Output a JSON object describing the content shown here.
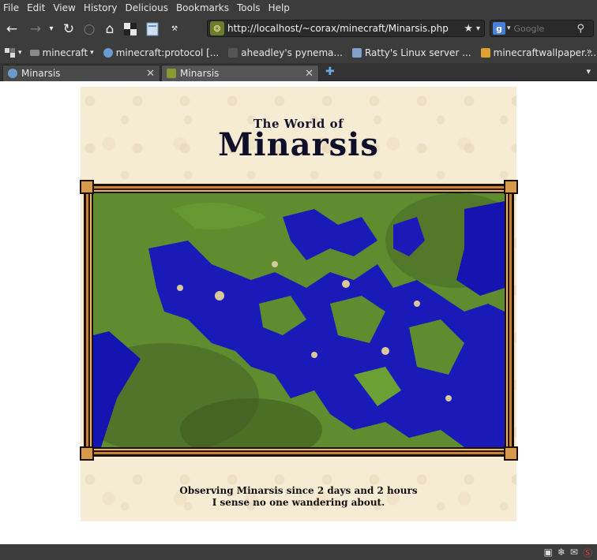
{
  "menu": [
    "File",
    "Edit",
    "View",
    "History",
    "Delicious",
    "Bookmarks",
    "Tools",
    "Help"
  ],
  "urlbar": {
    "url": "http://localhost/~corax/minecraft/Minarsis.php"
  },
  "search": {
    "placeholder": "Google"
  },
  "bookmarks": [
    {
      "label": "minecraft",
      "color": "#8a8a8a"
    },
    {
      "label": "minecraft:protocol [...",
      "color": "#6a9ad0"
    },
    {
      "label": "aheadley's pynema...",
      "color": "#444444"
    },
    {
      "label": "Ratty's Linux server ...",
      "color": "#7fa0c8"
    },
    {
      "label": "minecraftwallpaper....",
      "color": "#e0a030"
    }
  ],
  "tabs": [
    {
      "title": "Minarsis"
    },
    {
      "title": "Minarsis"
    }
  ],
  "page": {
    "title_small": "The World of",
    "title_big": "Minarsis",
    "status_line1": "Observing Minarsis since 2 days and 2 hours",
    "status_line2": "I sense no one wandering about."
  },
  "colors": {
    "chrome": "#3c3c3c",
    "parchment": "#f6ebd3",
    "water": "#1a1aa8",
    "land": "#5d8a2c"
  }
}
